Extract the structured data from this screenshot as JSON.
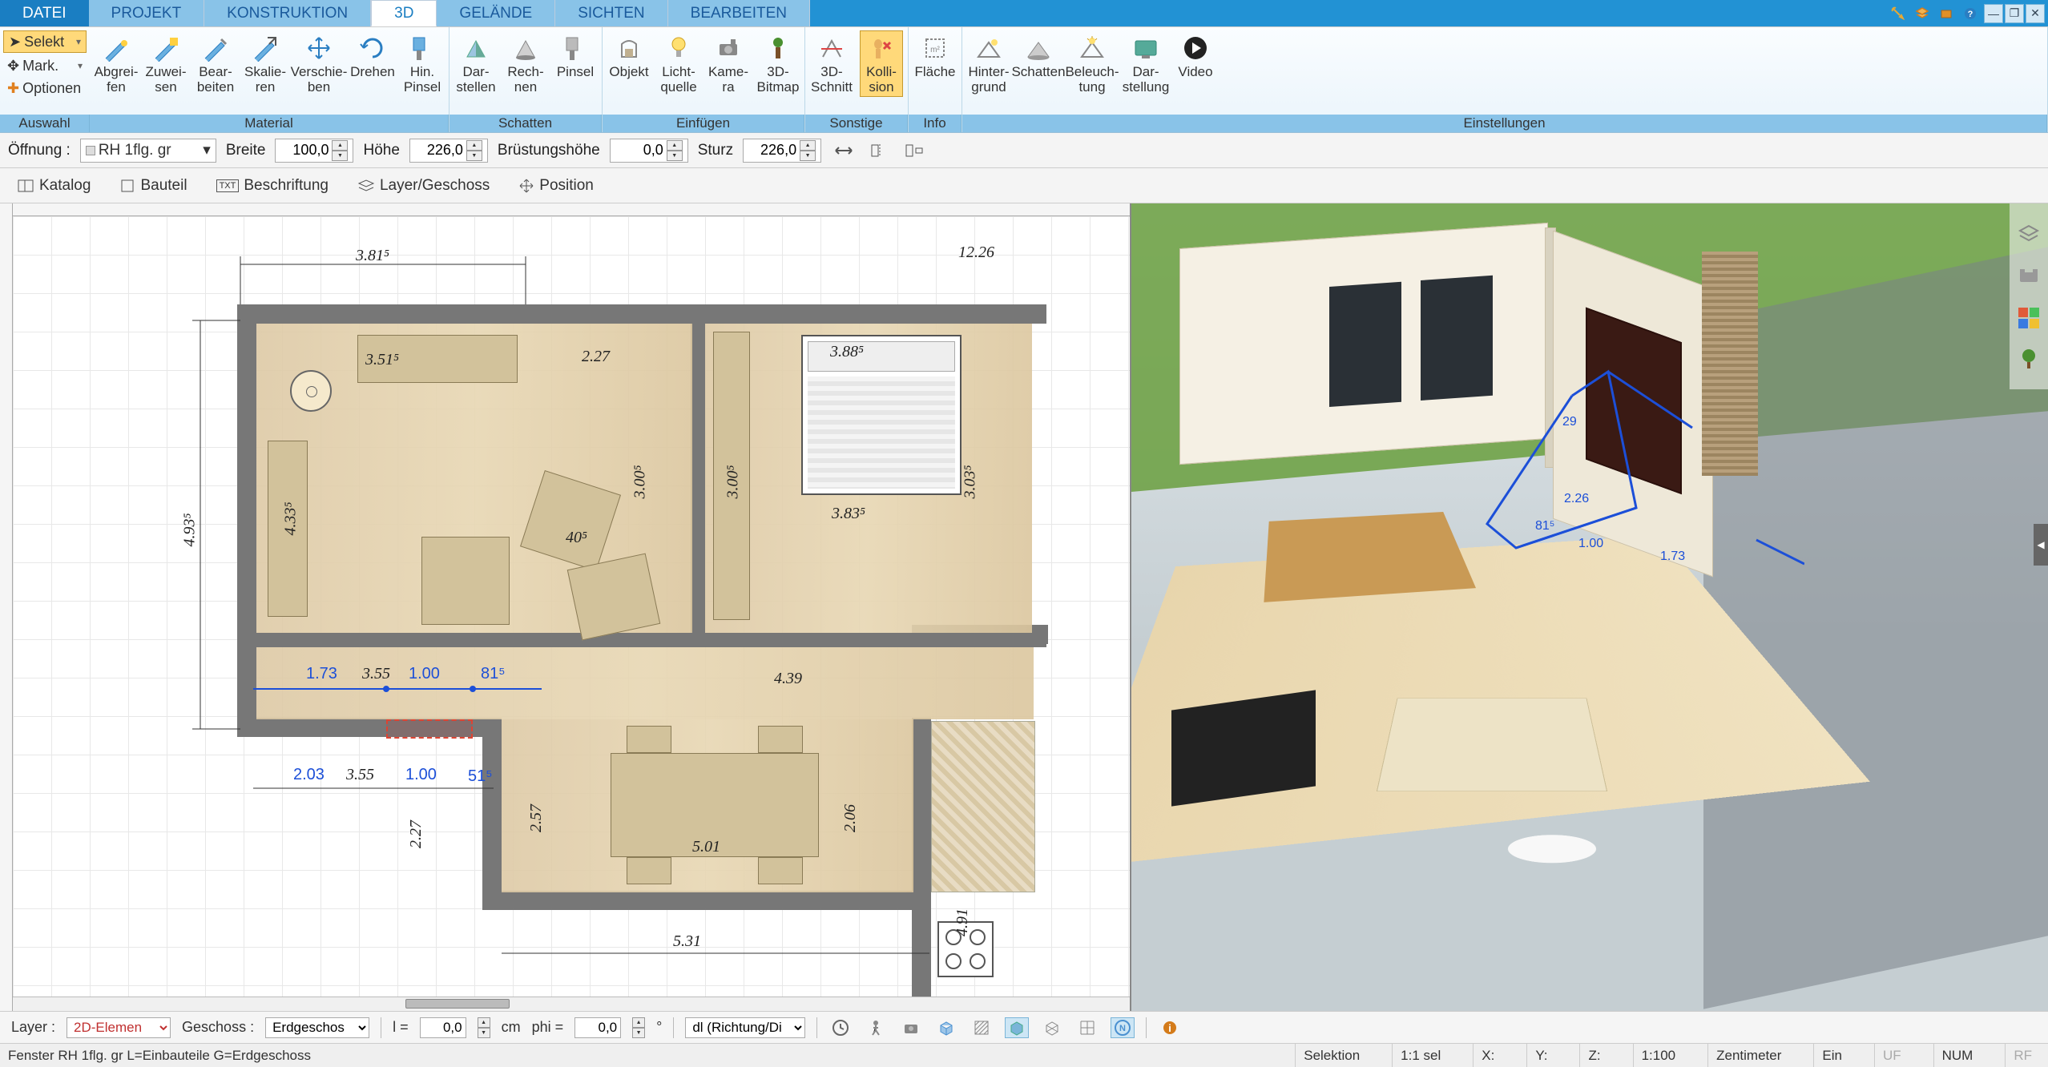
{
  "menu": {
    "file": "DATEI",
    "projekt": "PROJEKT",
    "konstruktion": "KONSTRUKTION",
    "d3": "3D",
    "gelaende": "GELÄNDE",
    "sichten": "SICHTEN",
    "bearbeiten": "BEARBEITEN"
  },
  "ribbon": {
    "auswahl": {
      "selekt": "Selekt",
      "mark": "Mark.",
      "optionen": "Optionen",
      "label": "Auswahl"
    },
    "material": {
      "abgreifen": "Abgrei-\nfen",
      "zuweisen": "Zuwei-\nsen",
      "bearbeiten": "Bear-\nbeiten",
      "skalieren": "Skalie-\nren",
      "verschieben": "Verschie-\nben",
      "drehen": "Drehen",
      "hinpinsel": "Hin.\nPinsel",
      "label": "Material"
    },
    "schatten": {
      "darstellen": "Dar-\nstellen",
      "rechnen": "Rech-\nnen",
      "pinsel": "Pinsel",
      "label": "Schatten"
    },
    "einfuegen": {
      "objekt": "Objekt",
      "lichtquelle": "Licht-\nquelle",
      "kamera": "Kame-\nra",
      "bitmap": "3D-\nBitmap",
      "label": "Einfügen"
    },
    "sonstige": {
      "schnitt": "3D-\nSchnitt",
      "kollision": "Kolli-\nsion",
      "label": "Sonstige"
    },
    "info": {
      "flaeche": "Fläche",
      "label": "Info"
    },
    "einstellungen": {
      "hintergrund": "Hinter-\ngrund",
      "schatten": "Schatten",
      "beleuchtung": "Beleuch-\ntung",
      "darstellung": "Dar-\nstellung",
      "video": "Video",
      "label": "Einstellungen"
    }
  },
  "propbar": {
    "oeffnung_label": "Öffnung :",
    "oeffnung_value": "RH 1flg. gr",
    "breite_label": "Breite",
    "breite_value": "100,0",
    "hoehe_label": "Höhe",
    "hoehe_value": "226,0",
    "bruestung_label": "Brüstungshöhe",
    "bruestung_value": "0,0",
    "sturz_label": "Sturz",
    "sturz_value": "226,0"
  },
  "propbar2": {
    "katalog": "Katalog",
    "bauteil": "Bauteil",
    "beschriftung": "Beschriftung",
    "layer": "Layer/Geschoss",
    "position": "Position"
  },
  "plan_dims": {
    "d1": "3.81⁵",
    "d2": "12.26",
    "d3": "4.93⁵",
    "d4": "3.51⁵",
    "d5": "2.27",
    "d6": "4.33⁵",
    "d7": "3.00⁵",
    "d8": "40⁵",
    "d9": "3.00⁵",
    "d10": "3.88⁵",
    "d11": "3.83⁵",
    "d12": "3.03⁵",
    "d13": "4.39",
    "d14": "2.03",
    "d15": "3.55",
    "d16": "1.00",
    "d17": "51⁵",
    "d18": "2.27",
    "d19": "2.57",
    "d20": "5.01",
    "d21": "2.06",
    "d22": "5.31",
    "d23": "4.91",
    "sel1": "1.73",
    "sel2": "3.55",
    "sel3": "1.00",
    "sel4": "81⁵"
  },
  "dims3d": {
    "a": "2.26",
    "b": "1.00",
    "c": "81⁵",
    "d": "1.73",
    "e": "29"
  },
  "bottom": {
    "layer_label": "Layer :",
    "layer_value": "2D-Elemen",
    "geschoss_label": "Geschoss :",
    "geschoss_value": "Erdgeschos",
    "l_label": "l =",
    "l_value": "0,0",
    "cm": "cm",
    "phi_label": "phi =",
    "phi_value": "0,0",
    "deg": "°",
    "dl_label": "dl (Richtung/Di"
  },
  "status": {
    "left": "Fenster RH 1flg. gr L=Einbauteile G=Erdgeschoss",
    "selektion": "Selektion",
    "sel_count": "1:1 sel",
    "x": "X:",
    "y": "Y:",
    "z": "Z:",
    "scale": "1:100",
    "unit": "Zentimeter",
    "ein": "Ein",
    "uf": "UF",
    "num": "NUM",
    "rf": "RF"
  }
}
